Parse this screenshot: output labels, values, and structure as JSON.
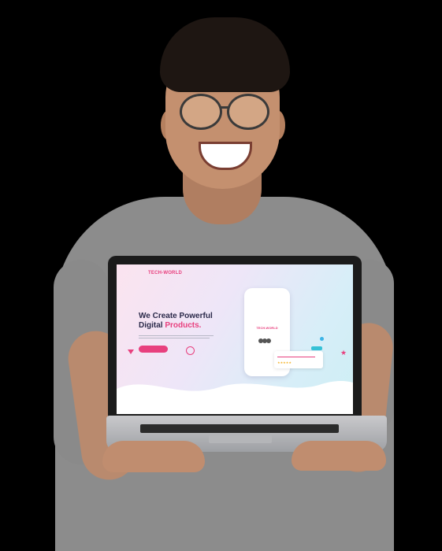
{
  "screen": {
    "brand": "TECH-WORLD",
    "hero": {
      "title_line1": "We Create Powerful",
      "title_line2_plain": "Digital ",
      "title_line2_accent": "Products."
    },
    "phone_brand": "TECH-WORLD",
    "colors": {
      "accent": "#e8407e",
      "dark": "#2b2a4a",
      "teal": "#35c1d6",
      "stars": "#f5b32a"
    }
  }
}
